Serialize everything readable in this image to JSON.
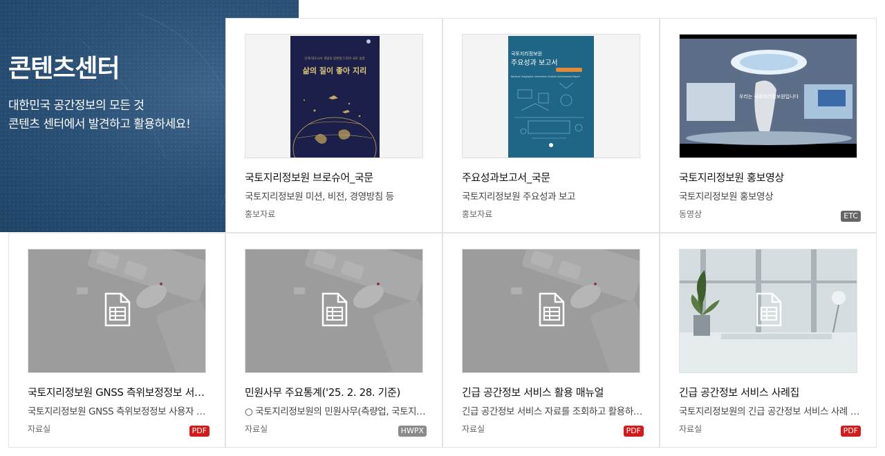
{
  "hero": {
    "title": "콘텐츠센터",
    "subtitle_line1": "대한민국 공간정보의 모든 것",
    "subtitle_line2": "콘텐츠 센터에서 발견하고 활용하세요!"
  },
  "colors": {
    "hero_bg": "#2c5278",
    "pdf_badge": "#d21b1b",
    "hwpx_badge": "#8a8a8a",
    "etc_badge": "#666666"
  },
  "cards": [
    {
      "title": "국토지리정보원 브로슈어_국문",
      "desc": "국토지리정보원 미션, 비전, 경영방침 등",
      "category": "홍보자료",
      "badge": "",
      "cover_tagline": "단계 대도시수 개방의 정판형 드라마 국토 설명",
      "cover_title": "삶의 질이 좋아 지리"
    },
    {
      "title": "주요성과보고서_국문",
      "desc": "국토지리정보원 주요성과 보고",
      "category": "홍보자료",
      "badge": "",
      "cover_org": "국토지리정보원",
      "cover_title": "주요성과 보고서",
      "cover_sub": "National Geographic Information Institute Achievement Report"
    },
    {
      "title": "국토지리정보원 홍보영상",
      "desc": "국토지리정보원 홍보영상",
      "category": "동영상",
      "badge": "ETC",
      "video_caption": "우리는 국토지리정보원입니다"
    },
    {
      "title": "국토지리정보원 GNSS 측위보정정보 서비스 사용자 매뉴얼",
      "desc": "국토지리정보원 GNSS 측위보정정보 사용자 매뉴얼",
      "category": "자료실",
      "badge": "PDF"
    },
    {
      "title": "민원사무 주요통계('25. 2. 28. 기준)",
      "desc": "○ 국토지리정보원의 민원사무(측량업, 국토지리정보 제공 등)",
      "category": "자료실",
      "badge": "HWPX"
    },
    {
      "title": "긴급 공간정보 서비스 활용 매뉴얼",
      "desc": "긴급 공간정보 서비스 자료를 조회하고 활용하는 방법",
      "category": "자료실",
      "badge": "PDF"
    },
    {
      "title": "긴급 공간정보 서비스 사례집",
      "desc": "국토지리정보원의 긴급 공간정보 서비스 사례 모음",
      "category": "자료실",
      "badge": "PDF"
    }
  ]
}
